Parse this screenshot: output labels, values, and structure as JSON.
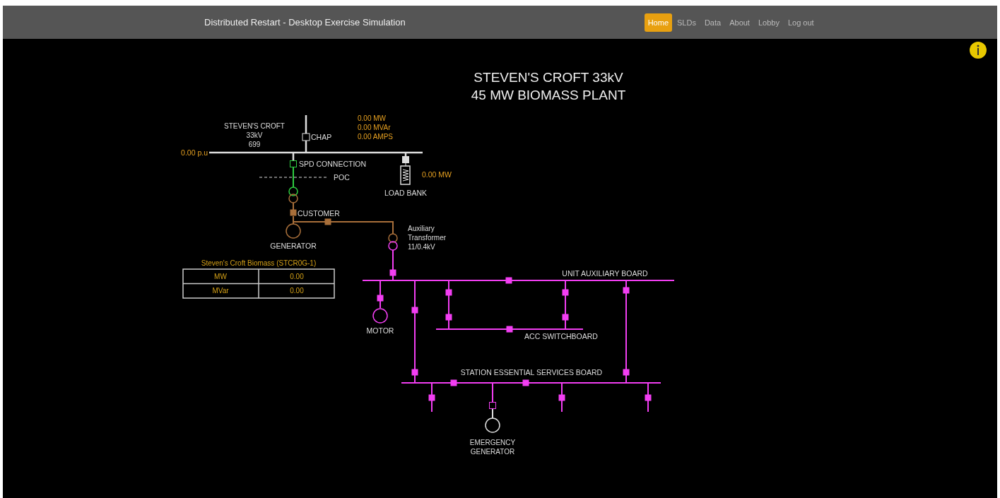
{
  "navbar": {
    "title": "Distributed Restart - Desktop Exercise Simulation",
    "items": [
      {
        "label": "Home",
        "selected": true
      },
      {
        "label": "SLDs",
        "selected": false
      },
      {
        "label": "Data",
        "selected": false
      },
      {
        "label": "About",
        "selected": false
      },
      {
        "label": "Lobby",
        "selected": false
      },
      {
        "label": "Log out",
        "selected": false
      }
    ]
  },
  "diagram": {
    "title": [
      "STEVEN'S CROFT 33kV",
      "45 MW BIOMASS PLANT"
    ],
    "substation": [
      "STEVEN'S CROFT",
      "33kV",
      "699"
    ],
    "bus_voltage": "0.00 p.u",
    "chap": {
      "label": "CHAP",
      "readings": [
        "0.00 MW",
        "0.00 MVAr",
        "0.00 AMPS"
      ]
    },
    "spd_label": "SPD CONNECTION",
    "poc_label": "POC",
    "load_bank": {
      "label": "LOAD BANK",
      "reading": "0.00 MW"
    },
    "customer_label": "CUSTOMER",
    "generator_label": "GENERATOR",
    "aux_transformer": [
      "Auxiliary",
      "Transformer",
      "11/0.4kV"
    ],
    "unit_board_label": "UNIT AUXILIARY BOARD",
    "motor_label": "MOTOR",
    "acc_label": "ACC SWITCHBOARD",
    "station_board_label": "STATION ESSENTIAL SERVICES BOARD",
    "emergency_generator": [
      "EMERGENCY",
      "GENERATOR"
    ],
    "breakers": [
      {
        "closed": false
      },
      {
        "closed": true
      },
      {
        "closed": false
      },
      {
        "closed": true
      },
      {
        "closed": true
      },
      {
        "closed": true
      },
      {
        "closed": true
      },
      {
        "closed": true
      },
      {
        "closed": true
      },
      {
        "closed": true
      },
      {
        "closed": true
      },
      {
        "closed": true
      },
      {
        "closed": true
      },
      {
        "closed": true
      },
      {
        "closed": true
      },
      {
        "closed": true
      },
      {
        "closed": true
      },
      {
        "closed": true
      },
      {
        "closed": true
      },
      {
        "closed": true
      },
      {
        "closed": true
      },
      {
        "closed": true
      },
      {
        "closed": false
      }
    ],
    "unit_table": {
      "title": "Steven's Croft Biomass (STCR0G-1)",
      "rows": [
        [
          "MW",
          "0.00"
        ],
        [
          "MVar",
          "0.00"
        ]
      ]
    }
  }
}
